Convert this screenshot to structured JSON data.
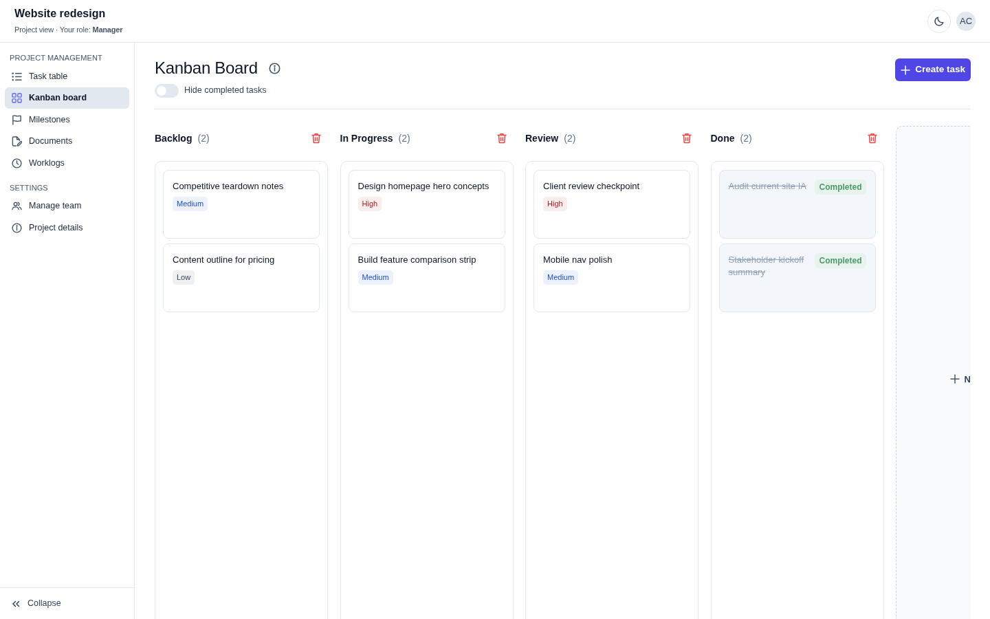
{
  "app_header": {
    "title": "Website redesign",
    "subtitle": "Project view · Your role: **Manager**",
    "avatar": "AC"
  },
  "sidebar": {
    "sections": [
      {
        "heading": "PROJECT MANAGEMENT",
        "items": [
          {
            "label": "Task table",
            "selected": false
          },
          {
            "label": "Kanban board",
            "selected": true
          },
          {
            "label": "Milestones",
            "selected": false
          },
          {
            "label": "Documents",
            "selected": false
          },
          {
            "label": "Worklogs",
            "selected": false
          }
        ]
      },
      {
        "heading": "SETTINGS",
        "items": [
          {
            "label": "Manage team",
            "selected": false
          },
          {
            "label": "Project details",
            "selected": false
          }
        ]
      }
    ],
    "collapse": "Collapse"
  },
  "page": {
    "title": "Kanban Board",
    "hide_completed": {
      "label": "Hide completed tasks",
      "on": false
    },
    "create_button": "Create task"
  },
  "board": {
    "columns": [
      {
        "title": "Backlog",
        "count": "(2)",
        "cards": [
          {
            "title": "Competitive teardown notes",
            "completed": false,
            "badge": {
              "text": "Medium",
              "color": "#1d4ed8"
            }
          },
          {
            "title": "Content outline for pricing",
            "completed": false,
            "badge": {
              "text": "Low",
              "color": "#334155"
            }
          }
        ]
      },
      {
        "title": "In Progress",
        "count": "(2)",
        "cards": [
          {
            "title": "Design homepage hero concepts",
            "completed": false,
            "badge": {
              "text": "High",
              "color": "#b91c1c"
            }
          },
          {
            "title": "Build feature comparison strip",
            "completed": false,
            "badge": {
              "text": "Medium",
              "color": "#1d4ed8"
            }
          }
        ]
      },
      {
        "title": "Review",
        "count": "(2)",
        "cards": [
          {
            "title": "Client review checkpoint",
            "completed": false,
            "badge": {
              "text": "High",
              "color": "#b91c1c"
            }
          },
          {
            "title": "Mobile nav polish",
            "completed": false,
            "badge": {
              "text": "Medium",
              "color": "#1d4ed8"
            }
          }
        ]
      },
      {
        "title": "Done",
        "count": "(2)",
        "cards": [
          {
            "title": "Audit current site IA",
            "completed": true,
            "badge": {
              "text": "Completed",
              "color": "#4a9b6a"
            }
          },
          {
            "title": "Stakeholder kickoff summary",
            "completed": true,
            "badge": {
              "text": "Completed",
              "color": "#4a9b6a"
            }
          }
        ]
      }
    ],
    "add_column": {
      "label": "N"
    }
  }
}
